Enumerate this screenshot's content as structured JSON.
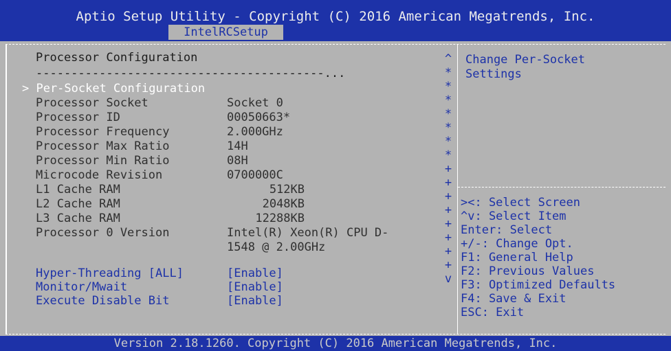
{
  "header": {
    "title": "Aptio Setup Utility - Copyright (C) 2016 American Megatrends, Inc.",
    "tab": "IntelRCSetup"
  },
  "main": {
    "heading": "Processor Configuration",
    "separator": "-----------------------------------------...",
    "selected_item": "> Per-Socket Configuration",
    "info": [
      {
        "label": "Processor Socket",
        "value": "Socket 0"
      },
      {
        "label": "Processor ID",
        "value": "00050663*"
      },
      {
        "label": "Processor Frequency",
        "value": "2.000GHz"
      },
      {
        "label": "Processor Max Ratio",
        "value": "14H"
      },
      {
        "label": "Processor Min Ratio",
        "value": "08H"
      },
      {
        "label": "Microcode Revision",
        "value": "0700000C"
      },
      {
        "label": "L1 Cache RAM",
        "value": "512KB"
      },
      {
        "label": "L2 Cache RAM",
        "value": "2048KB"
      },
      {
        "label": "L3 Cache RAM",
        "value": "12288KB"
      },
      {
        "label": "Processor 0 Version",
        "value": "Intel(R) Xeon(R) CPU D-"
      },
      {
        "label": "",
        "value": "1548 @ 2.00GHz"
      }
    ],
    "options": [
      {
        "label": "Hyper-Threading [ALL]",
        "value": "[Enable]"
      },
      {
        "label": "Monitor/Mwait",
        "value": "[Enable]"
      },
      {
        "label": "Execute Disable Bit",
        "value": "[Enable]"
      }
    ]
  },
  "scrollbar": {
    "up": "^",
    "thumb": "*",
    "track": "+",
    "down": "v"
  },
  "help": {
    "description": [
      "Change Per-Socket",
      "Settings"
    ],
    "separator": "-------------------------",
    "keys": [
      "><: Select Screen",
      "^v: Select Item",
      "Enter: Select",
      "+/-: Change Opt.",
      "F1: General Help",
      "F2: Previous Values",
      "F3: Optimized Defaults",
      "F4: Save & Exit",
      "ESC: Exit"
    ]
  },
  "footer": {
    "text": "Version 2.18.1260. Copyright (C) 2016 American Megatrends, Inc."
  },
  "colors": {
    "header_bg": "#1d32a8",
    "panel_bg": "#b3b3b3",
    "selected_text": "#ffffff",
    "option_text": "#1d32a8"
  }
}
